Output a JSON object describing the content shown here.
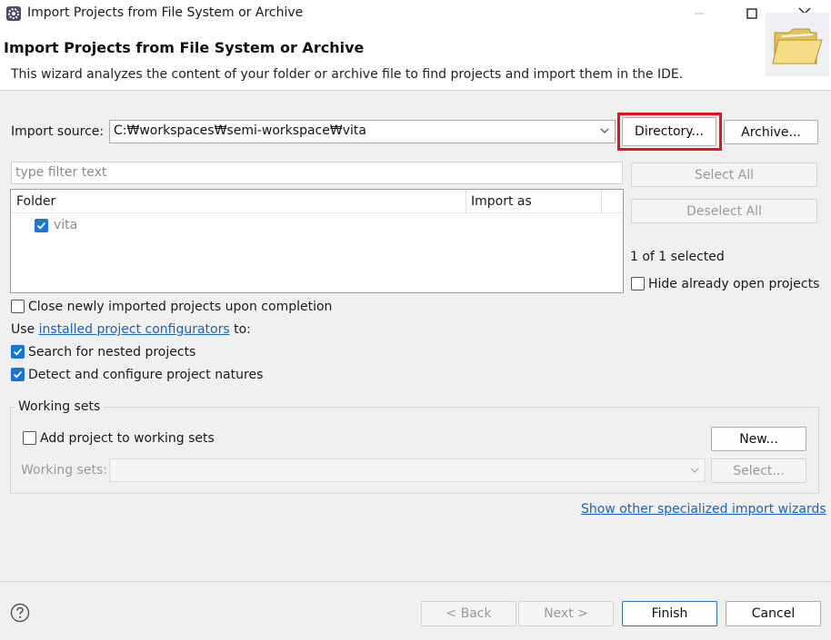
{
  "window": {
    "title": "Import Projects from File System or Archive",
    "minimize_icon": "minimize-icon",
    "maximize_icon": "maximize-icon",
    "close_icon": "close-icon"
  },
  "header": {
    "title": "Import Projects from File System or Archive",
    "description": "This wizard analyzes the content of your folder or archive file to find projects and import them in the IDE.",
    "icon": "folder-icon"
  },
  "import_source": {
    "label": "Import source:",
    "value": "C:₩workspaces₩semi-workspace₩vita",
    "directory_button": "Directory...",
    "archive_button": "Archive..."
  },
  "filter": {
    "placeholder": "type filter text"
  },
  "tree": {
    "columns": [
      "Folder",
      "Import as"
    ],
    "rows": [
      {
        "folder": "vita",
        "import_as": "",
        "checked": true
      }
    ]
  },
  "side_buttons": {
    "select_all": "Select All",
    "deselect_all": "Deselect All",
    "selected_count": "1 of 1 selected",
    "hide_open_label": "Hide already open projects"
  },
  "options": {
    "close_imported": "Close newly imported projects upon completion",
    "use_prefix": "Use ",
    "configurators_link": "installed project configurators",
    "use_suffix": " to:",
    "search_nested": "Search for nested projects",
    "detect_natures": "Detect and configure project natures"
  },
  "working_sets": {
    "group_title": "Working sets",
    "add_label": "Add project to working sets",
    "new_button": "New...",
    "sets_label": "Working sets:",
    "select_button": "Select..."
  },
  "show_other_link": "Show other specialized import wizards",
  "footer": {
    "help_icon": "help-icon",
    "back": "< Back",
    "next": "Next >",
    "finish": "Finish",
    "cancel": "Cancel"
  },
  "colors": {
    "accent": "#1a73d8",
    "link": "#1e63b5",
    "highlight_box": "#e3141e"
  }
}
